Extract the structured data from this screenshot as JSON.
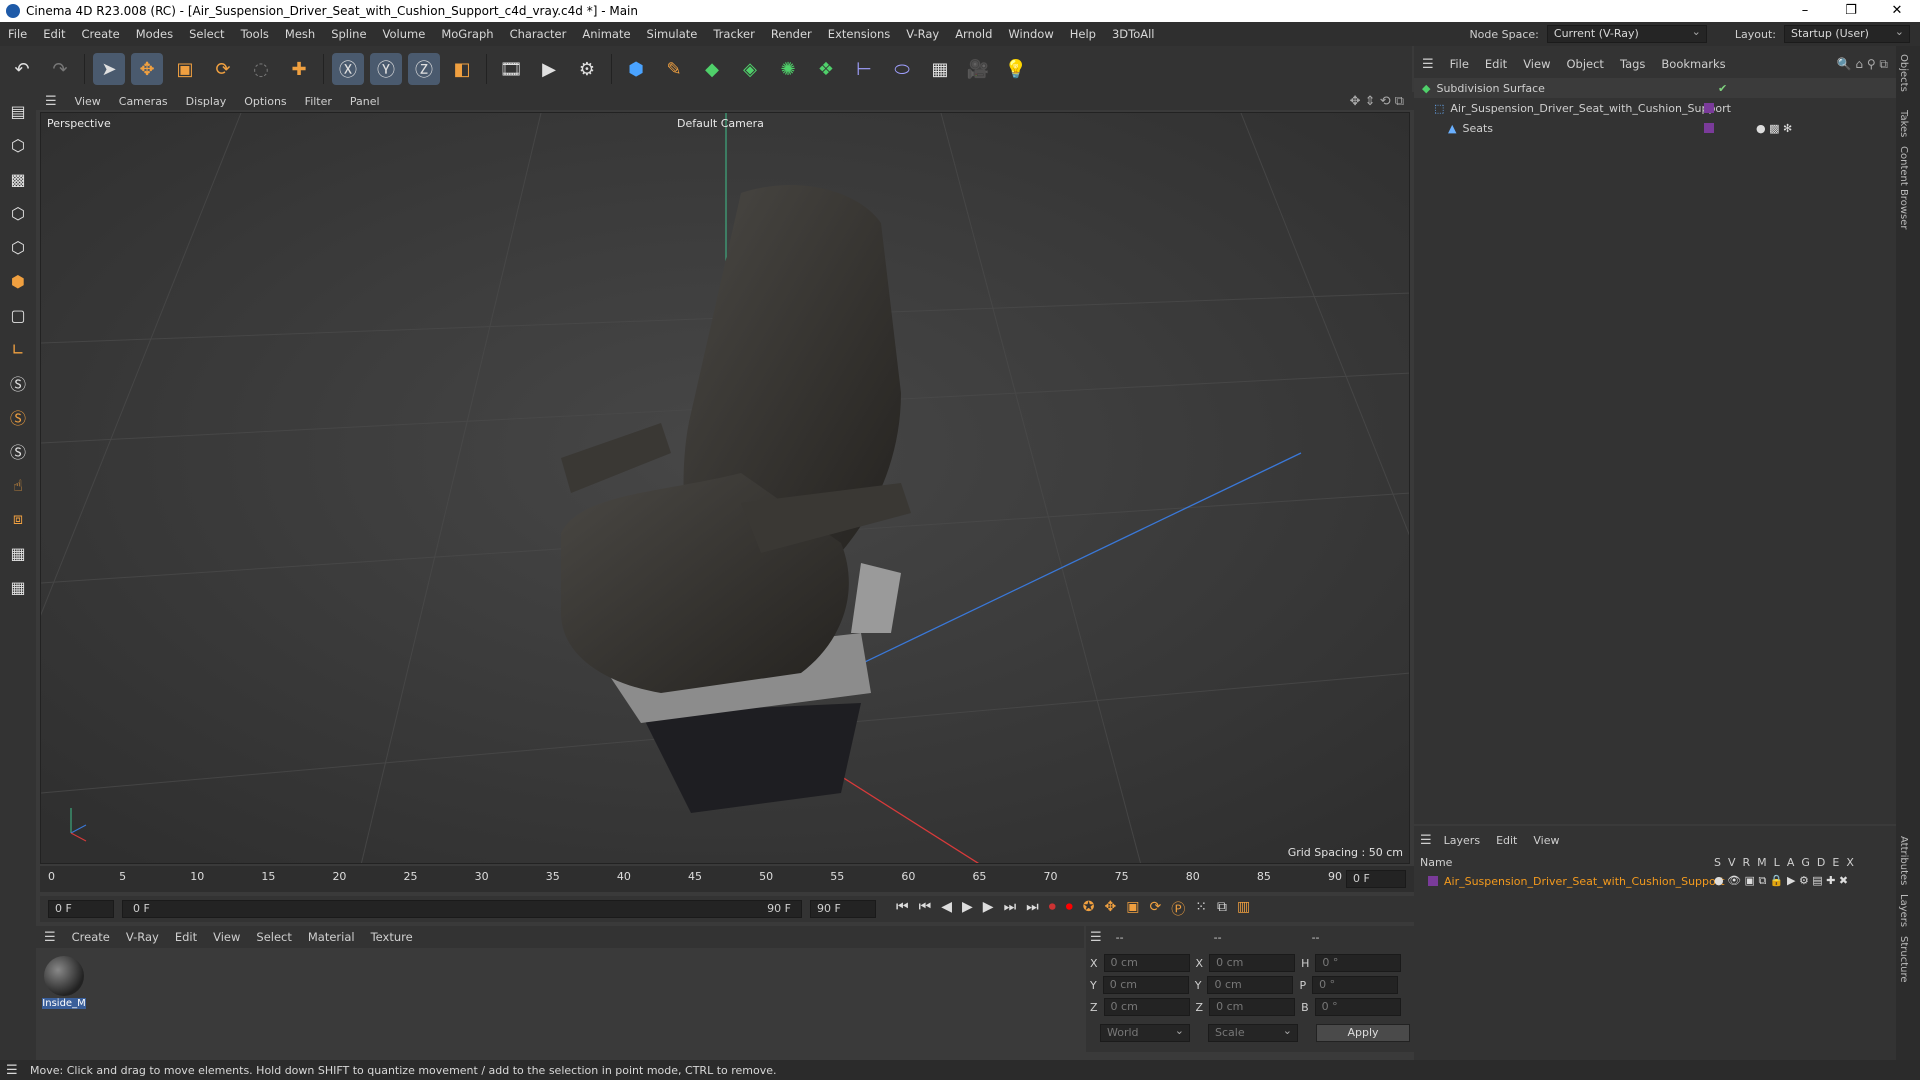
{
  "window": {
    "title": "Cinema 4D R23.008 (RC) - [Air_Suspension_Driver_Seat_with_Cushion_Support_c4d_vray.c4d *] - Main",
    "minimize": "–",
    "maximize": "❐",
    "close": "✕"
  },
  "menubar": {
    "items": [
      "File",
      "Edit",
      "Create",
      "Modes",
      "Select",
      "Tools",
      "Mesh",
      "Spline",
      "Volume",
      "MoGraph",
      "Character",
      "Animate",
      "Simulate",
      "Tracker",
      "Render",
      "Extensions",
      "V-Ray",
      "Arnold",
      "Window",
      "Help",
      "3DToAll"
    ],
    "node_space_label": "Node Space:",
    "node_space_value": "Current (V-Ray)",
    "layout_label": "Layout:",
    "layout_value": "Startup (User)"
  },
  "viewport": {
    "menu": [
      "View",
      "Cameras",
      "Display",
      "Options",
      "Filter",
      "Panel"
    ],
    "label": "Perspective",
    "camera": "Default Camera",
    "grid_spacing": "Grid Spacing : 50 cm"
  },
  "timeline": {
    "ticks": [
      "0",
      "5",
      "10",
      "15",
      "20",
      "25",
      "30",
      "35",
      "40",
      "45",
      "50",
      "55",
      "60",
      "65",
      "70",
      "75",
      "80",
      "85",
      "90"
    ],
    "current_frame": "0 F",
    "start_field": "0 F",
    "range_start": "0 F",
    "range_end": "90 F",
    "end_field": "90 F"
  },
  "material_manager": {
    "menu": [
      "Create",
      "V-Ray",
      "Edit",
      "View",
      "Select",
      "Material",
      "Texture"
    ],
    "material_name": "Inside_M"
  },
  "coordinates": {
    "header": [
      "--",
      "--",
      "--"
    ],
    "rows": [
      {
        "a": "X",
        "av": "0 cm",
        "b": "X",
        "bv": "0 cm",
        "c": "H",
        "cv": "0 °"
      },
      {
        "a": "Y",
        "av": "0 cm",
        "b": "Y",
        "bv": "0 cm",
        "c": "P",
        "cv": "0 °"
      },
      {
        "a": "Z",
        "av": "0 cm",
        "b": "Z",
        "bv": "0 cm",
        "c": "B",
        "cv": "0 °"
      }
    ],
    "world": "World",
    "scale": "Scale",
    "apply": "Apply"
  },
  "objects": {
    "menu": [
      "File",
      "Edit",
      "View",
      "Object",
      "Tags",
      "Bookmarks"
    ],
    "items": [
      {
        "name": "Subdivision Surface"
      },
      {
        "name": "Air_Suspension_Driver_Seat_with_Cushion_Support"
      },
      {
        "name": "Seats"
      }
    ]
  },
  "layers": {
    "menu": [
      "Layers",
      "Edit",
      "View"
    ],
    "name_header": "Name",
    "cols": [
      "S",
      "V",
      "R",
      "M",
      "L",
      "A",
      "G",
      "D",
      "E",
      "X"
    ],
    "item": "Air_Suspension_Driver_Seat_with_Cushion_Support"
  },
  "side_tabs": [
    "Objects",
    "Takes",
    "Content Browser",
    "Attributes",
    "Layers",
    "Structure"
  ],
  "status": "Move: Click and drag to move elements. Hold down SHIFT to quantize movement / add to the selection in point mode, CTRL to remove.",
  "colors": {
    "accent": "#f39a1e",
    "selected": "#4a5a6e",
    "layer_purple": "#7a3b9a"
  }
}
